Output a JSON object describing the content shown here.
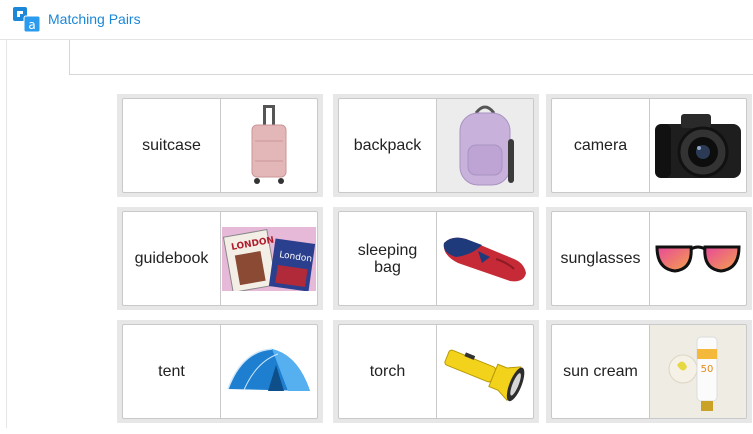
{
  "app": {
    "title": "Matching Pairs",
    "logo_letter": "a",
    "brand_color": "#1a87d8"
  },
  "cards": [
    {
      "word": "suitcase",
      "image_icon": "suitcase-image"
    },
    {
      "word": "backpack",
      "image_icon": "backpack-image"
    },
    {
      "word": "camera",
      "image_icon": "camera-image"
    },
    {
      "word": "guidebook",
      "image_icon": "guidebook-image",
      "image_text": [
        "LONDON",
        "London"
      ]
    },
    {
      "word": "sleeping bag",
      "image_icon": "sleeping-bag-image"
    },
    {
      "word": "sunglasses",
      "image_icon": "sunglasses-image"
    },
    {
      "word": "tent",
      "image_icon": "tent-image"
    },
    {
      "word": "torch",
      "image_icon": "torch-image"
    },
    {
      "word": "sun cream",
      "image_icon": "sun-cream-image",
      "image_text": [
        "50"
      ]
    }
  ]
}
